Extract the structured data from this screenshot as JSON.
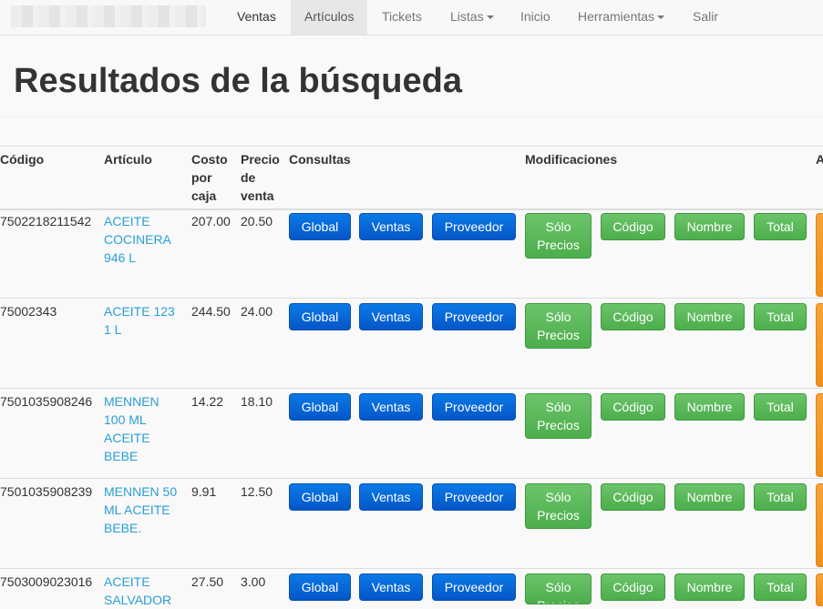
{
  "nav": {
    "items": [
      {
        "label": "Ventas"
      },
      {
        "label": "Artículos"
      },
      {
        "label": "Tickets"
      },
      {
        "label": "Listas"
      },
      {
        "label": "Inicio"
      },
      {
        "label": "Herramientas"
      },
      {
        "label": "Salir"
      }
    ]
  },
  "page": {
    "title": "Resultados de la búsqueda"
  },
  "table": {
    "headers": {
      "codigo": "Código",
      "articulo": "Artículo",
      "costo": "Costo por caja",
      "precio": "Precio de venta",
      "consultas": "Consultas",
      "modificaciones": "Modificaciones",
      "extra": "A"
    },
    "buttons": {
      "global": "Global",
      "ventas": "Ventas",
      "proveedor": "Proveedor",
      "solo": "Sólo",
      "precios": "Precios",
      "codigo": "Código",
      "nombre": "Nombre",
      "total": "Total"
    },
    "rows": [
      {
        "codigo": "7502218211542",
        "articulo": [
          "ACEITE",
          "COCINERA",
          "946 L"
        ],
        "costo": "207.00",
        "precio": "20.50"
      },
      {
        "codigo": "75002343",
        "articulo": [
          "ACEITE 123",
          "1 L"
        ],
        "costo": "244.50",
        "precio": "24.00"
      },
      {
        "codigo": "7501035908246",
        "articulo": [
          "MENNEN",
          "100 ML",
          "ACEITE",
          "BEBE"
        ],
        "costo": "14.22",
        "precio": "18.10"
      },
      {
        "codigo": "7501035908239",
        "articulo": [
          "MENNEN 50",
          "ML ACEITE",
          "BEBE."
        ],
        "costo": "9.91",
        "precio": "12.50"
      },
      {
        "codigo": "7503009023016",
        "articulo": [
          "ACEITE",
          "SALVADOR"
        ],
        "costo": "27.50",
        "precio": "3.00"
      }
    ]
  }
}
